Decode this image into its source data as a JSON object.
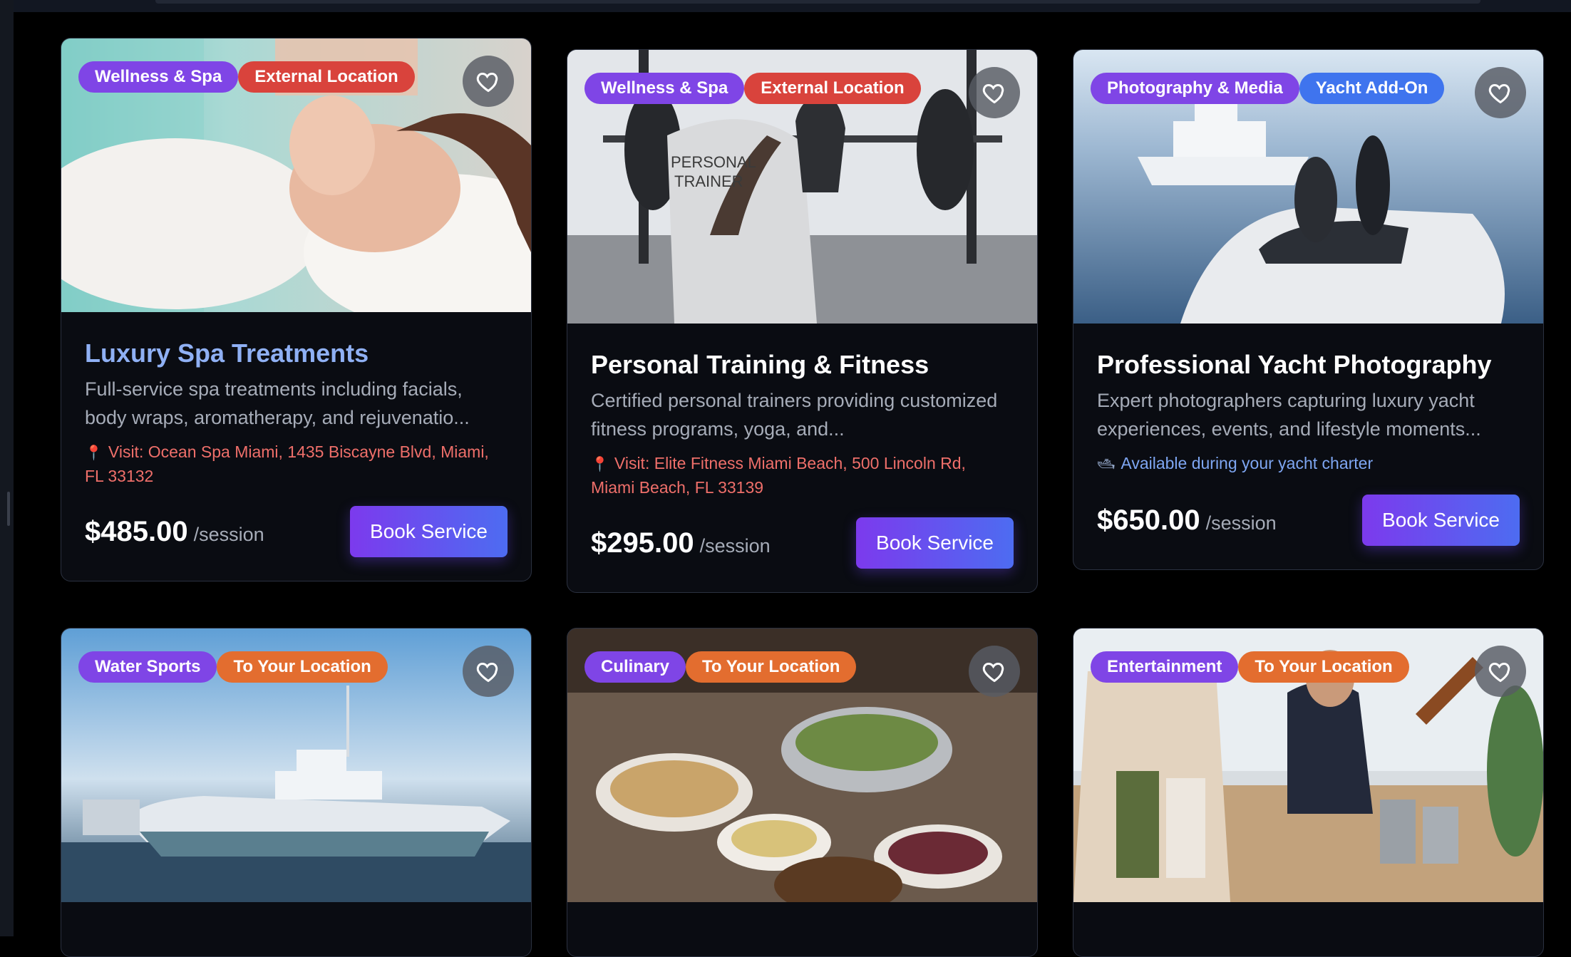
{
  "colors": {
    "page_bg": "#000000",
    "card_bg": "#0a0c12",
    "accent_purple": "#7f45e6",
    "accent_red": "#d9433c",
    "accent_blue": "#3f74ee",
    "accent_orange": "#e36d2f",
    "title_highlight": "#8fb0f4"
  },
  "cards": [
    {
      "badges": [
        "Wellness & Spa",
        "External Location"
      ],
      "title": "Luxury Spa Treatments",
      "description": "Full-service spa treatments including facials, body wraps, aromatherapy, and rejuvenatio...",
      "location": "Visit: Ocean Spa Miami, 1435 Biscayne Blvd, Miami, FL 33132",
      "location_icon": "pin-icon",
      "price": "$485.00",
      "unit": "/session",
      "button": "Book Service"
    },
    {
      "badges": [
        "Wellness & Spa",
        "External Location"
      ],
      "title": "Personal Training & Fitness",
      "description": "Certified personal trainers providing customized fitness programs, yoga, and...",
      "location": "Visit: Elite Fitness Miami Beach, 500 Lincoln Rd, Miami Beach, FL 33139",
      "location_icon": "pin-icon",
      "price": "$295.00",
      "unit": "/session",
      "button": "Book Service",
      "image_text": [
        "PERSONAL",
        "TRAINER"
      ]
    },
    {
      "badges": [
        "Photography & Media",
        "Yacht Add-On"
      ],
      "title": "Professional Yacht Photography",
      "description": "Expert photographers capturing luxury yacht experiences, events, and lifestyle moments...",
      "location": "Available during your yacht charter",
      "location_icon": "yacht-icon",
      "price": "$650.00",
      "unit": "/session",
      "button": "Book Service"
    },
    {
      "badges": [
        "Water Sports",
        "To Your Location"
      ]
    },
    {
      "badges": [
        "Culinary",
        "To Your Location"
      ]
    },
    {
      "badges": [
        "Entertainment",
        "To Your Location"
      ]
    }
  ]
}
